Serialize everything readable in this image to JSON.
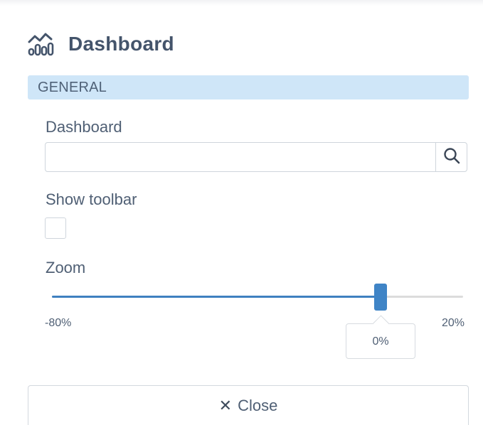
{
  "header": {
    "icon": "dashboard-chart-icon",
    "title": "Dashboard"
  },
  "section": {
    "title": "GENERAL"
  },
  "fields": {
    "dashboard": {
      "label": "Dashboard",
      "value": "",
      "placeholder": "",
      "button_icon": "search-icon"
    },
    "show_toolbar": {
      "label": "Show toolbar",
      "checked": false
    },
    "zoom": {
      "label": "Zoom",
      "min_label": "-80%",
      "max_label": "20%",
      "value_label": "0%",
      "min": -80,
      "max": 20,
      "value": 0
    }
  },
  "footer": {
    "close_icon": "close-icon",
    "close_label": "Close"
  },
  "colors": {
    "accent": "#3f84c6",
    "section_bg": "#cfe6f8",
    "text": "#4f5f74"
  }
}
